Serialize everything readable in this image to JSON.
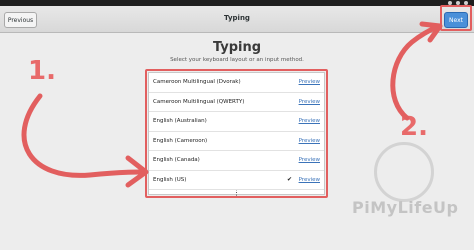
{
  "window": {
    "title": "Typing",
    "previous_label": "Previous",
    "next_label": "Next"
  },
  "page": {
    "title": "Typing",
    "subtitle": "Select your keyboard layout or an input method."
  },
  "layouts": [
    {
      "label": "Cameroon Multilingual (Dvorak)",
      "preview": "Preview",
      "selected": false
    },
    {
      "label": "Cameroon Multilingual (QWERTY)",
      "preview": "Preview",
      "selected": false
    },
    {
      "label": "English (Australian)",
      "preview": "Preview",
      "selected": false
    },
    {
      "label": "English (Cameroon)",
      "preview": "Preview",
      "selected": false
    },
    {
      "label": "English (Canada)",
      "preview": "Preview",
      "selected": false
    },
    {
      "label": "English (US)",
      "preview": "Preview",
      "selected": true,
      "check": "✔"
    }
  ],
  "more_icon": "vertical-ellipsis-icon",
  "more_glyph": "⋮",
  "annotations": {
    "step1": "1.",
    "step2": "2.",
    "color": "#e25f5f"
  },
  "watermark": "PiMyLifeUp"
}
